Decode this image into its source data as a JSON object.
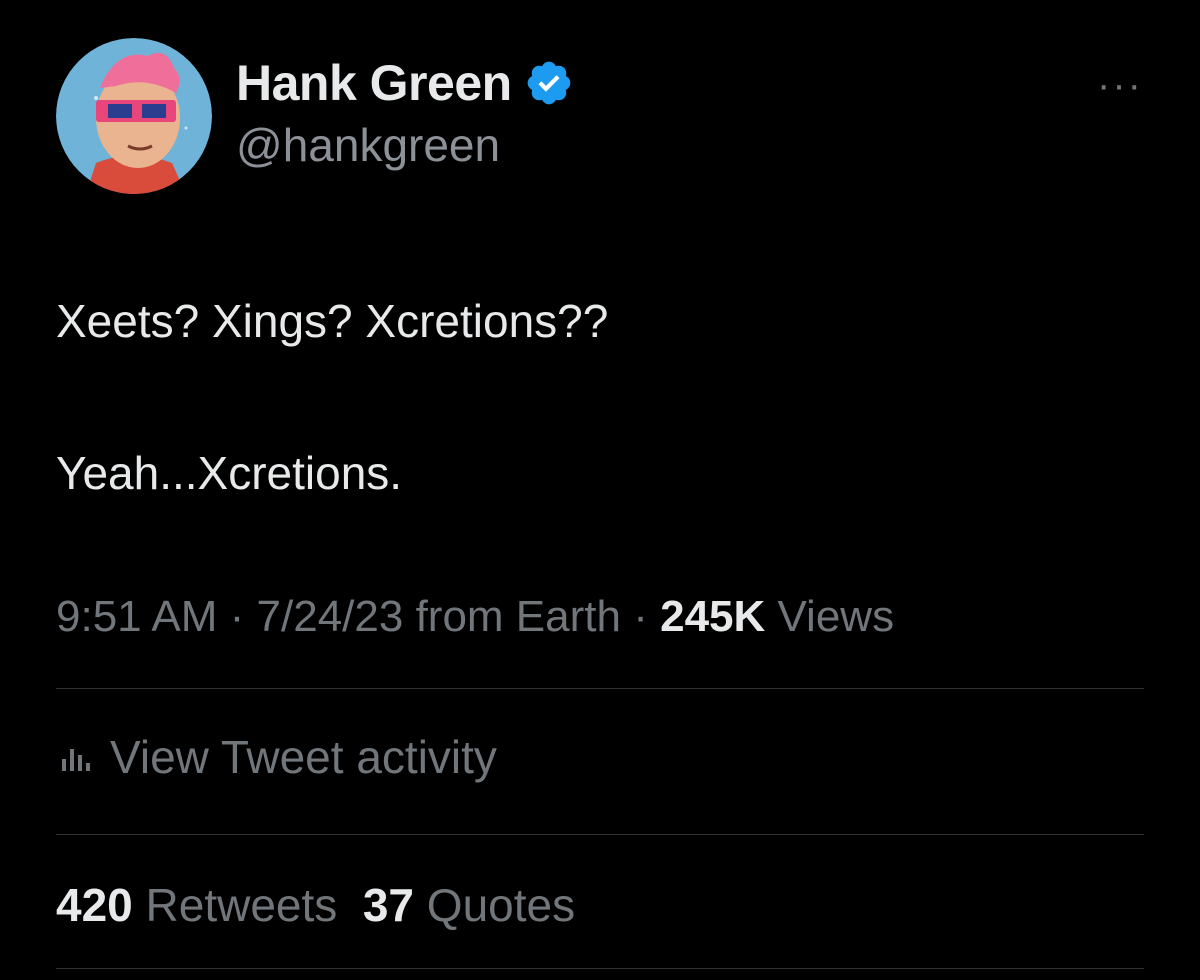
{
  "author": {
    "display_name": "Hank Green",
    "handle": "@hankgreen",
    "verified": true
  },
  "more_icon": "more-horizontal-icon",
  "tweet": {
    "line1": "Xeets? Xings? Xcretions??",
    "line2": "Yeah...Xcretions."
  },
  "meta": {
    "time": "9:51 AM",
    "sep1": " · ",
    "date": "7/24/23",
    "source": " from Earth",
    "sep2": " · ",
    "views_count": "245K",
    "views_label": " Views"
  },
  "activity": {
    "icon": "bar-chart-icon",
    "label": "View Tweet activity"
  },
  "stats": {
    "retweets_count": "420",
    "retweets_label": " Retweets",
    "quotes_count": "37",
    "quotes_label": " Quotes"
  },
  "colors": {
    "background": "#000000",
    "primary_text": "#e7e9ea",
    "secondary_text": "#71767b",
    "verified_blue": "#1d9bf0",
    "divider": "#2f3336"
  }
}
